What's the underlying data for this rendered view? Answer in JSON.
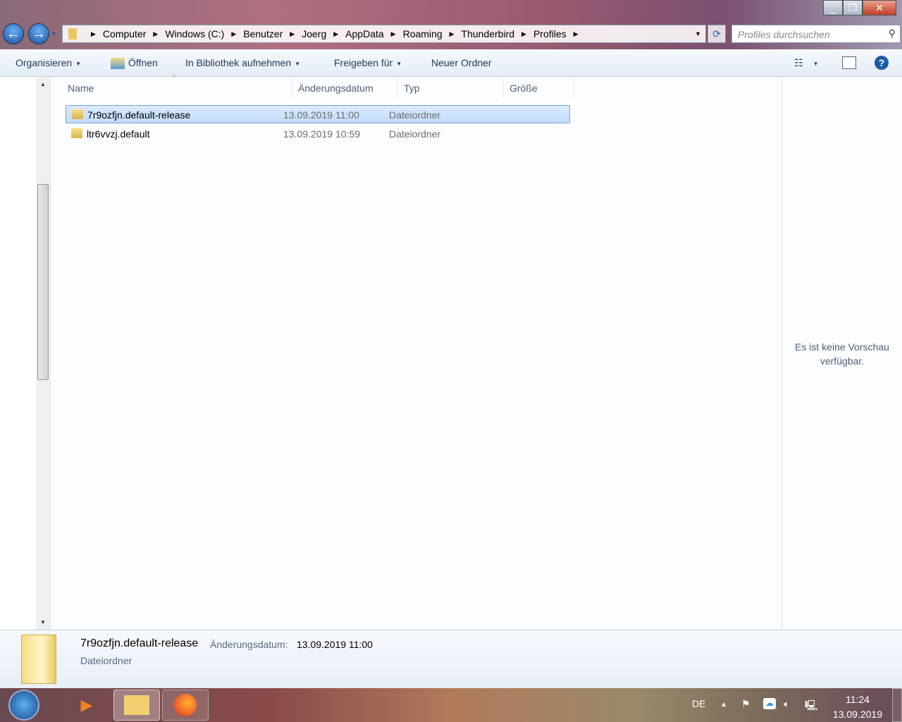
{
  "breadcrumb": [
    "Computer",
    "Windows (C:)",
    "Benutzer",
    "Joerg",
    "AppData",
    "Roaming",
    "Thunderbird",
    "Profiles"
  ],
  "search": {
    "placeholder": "Profiles durchsuchen"
  },
  "toolbar": {
    "organize": "Organisieren",
    "open": "Öffnen",
    "library": "In Bibliothek aufnehmen",
    "share": "Freigeben für",
    "new_folder": "Neuer Ordner"
  },
  "columns": {
    "name": "Name",
    "date": "Änderungsdatum",
    "type": "Typ",
    "size": "Größe"
  },
  "rows": [
    {
      "name": "7r9ozfjn.default-release",
      "date": "13.09.2019 11:00",
      "type": "Dateiordner",
      "selected": true
    },
    {
      "name": "ltr6vvzj.default",
      "date": "13.09.2019 10:59",
      "type": "Dateiordner",
      "selected": false
    }
  ],
  "preview": {
    "text": "Es ist keine Vorschau verfügbar."
  },
  "details": {
    "name": "7r9ozfjn.default-release",
    "date_label": "Änderungsdatum:",
    "date": "13.09.2019 11:00",
    "type": "Dateiordner"
  },
  "taskbar": {
    "lang": "DE",
    "time": "11:24",
    "date": "13.09.2019"
  }
}
